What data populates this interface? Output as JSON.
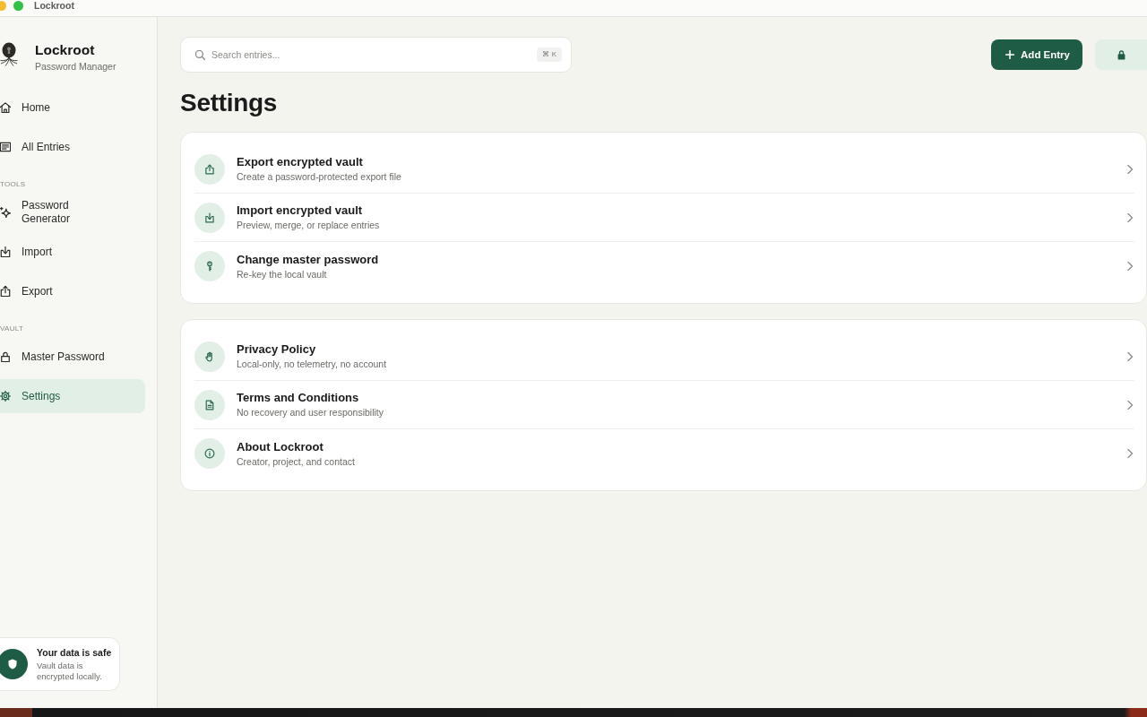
{
  "window": {
    "title": "Lockroot"
  },
  "sidebar": {
    "app_name": "Lockroot",
    "app_subtitle": "Password Manager",
    "sections": [
      {
        "items": [
          {
            "label": "Home",
            "selected": false
          },
          {
            "label": "All Entries",
            "selected": false
          }
        ]
      },
      {
        "heading": "TOOLS",
        "items": [
          {
            "label": "Password Generator",
            "selected": false
          },
          {
            "label": "Import",
            "selected": false
          },
          {
            "label": "Export",
            "selected": false
          }
        ]
      },
      {
        "heading": "VAULT",
        "items": [
          {
            "label": "Master Password",
            "selected": false
          },
          {
            "label": "Settings",
            "selected": true
          }
        ]
      }
    ],
    "safety_notice": {
      "title": "Your data is safe",
      "text": "Vault data is encrypted locally."
    }
  },
  "search": {
    "placeholder": "Search entries...",
    "shortcut": "⌘ K"
  },
  "add_button": {
    "label": "Add Entry"
  },
  "page_title": "Settings",
  "groups": [
    {
      "rows": [
        {
          "title": "Export encrypted vault",
          "description": "Create a password-protected export file"
        },
        {
          "title": "Import encrypted vault",
          "description": "Preview, merge, or replace entries"
        },
        {
          "title": "Change master password",
          "description": "Re-key the local vault"
        }
      ]
    },
    {
      "rows": [
        {
          "title": "Privacy Policy",
          "description": "Local-only, no telemetry, no account"
        },
        {
          "title": "Terms and Conditions",
          "description": "No recovery and user responsibility"
        },
        {
          "title": "About Lockroot",
          "description": "Creator, project, and contact"
        }
      ]
    }
  ]
}
